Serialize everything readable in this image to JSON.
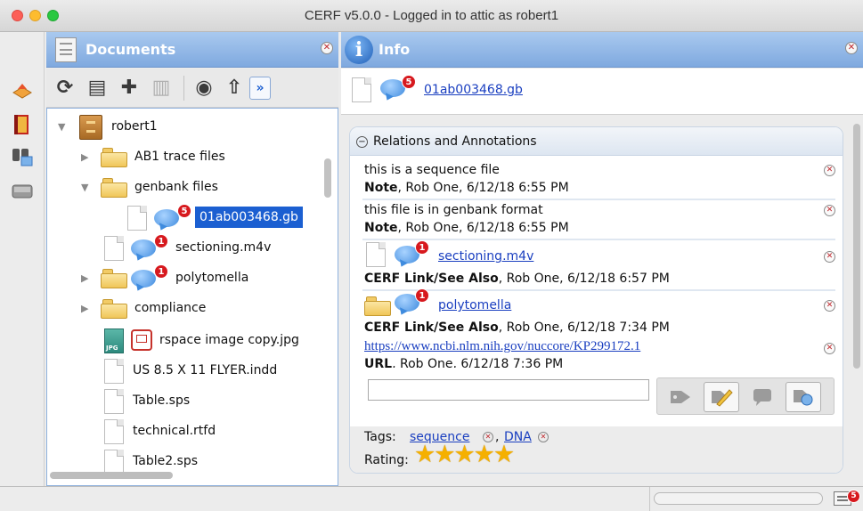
{
  "window": {
    "title": "CERF v5.0.0 - Logged in to attic as robert1",
    "lights": {
      "close": "#fc5f57",
      "minimize": "#fdbc2e",
      "zoom": "#29c840"
    }
  },
  "documents_panel": {
    "title": "Documents",
    "toolbar": [
      {
        "name": "refresh-icon",
        "glyph": "⟳"
      },
      {
        "name": "new-folder-icon",
        "glyph": "▤"
      },
      {
        "name": "add-icon",
        "glyph": "✚"
      },
      {
        "name": "drawer-icon",
        "glyph": "▥"
      },
      {
        "name": "view-icon",
        "glyph": "◉"
      },
      {
        "name": "upload-icon",
        "glyph": "⇧"
      },
      {
        "name": "more-icon",
        "glyph": "»"
      }
    ],
    "tree": [
      {
        "label": "robert1",
        "type": "root",
        "indent": 0,
        "expanded": true
      },
      {
        "label": "AB1 trace files",
        "type": "folder",
        "indent": 1,
        "expanded": false
      },
      {
        "label": "genbank files",
        "type": "folder",
        "indent": 1,
        "expanded": true
      },
      {
        "label": "01ab003468.gb",
        "type": "file",
        "indent": 2,
        "badge": "5",
        "selected": true
      },
      {
        "label": "sectioning.m4v",
        "type": "file",
        "indent": 1,
        "badge": "1"
      },
      {
        "label": "polytomella",
        "type": "folder",
        "indent": 1,
        "expanded": false,
        "badge": "1"
      },
      {
        "label": "compliance",
        "type": "folder",
        "indent": 1,
        "expanded": false
      },
      {
        "label": "rspace image copy.jpg",
        "type": "jpg",
        "indent": 1,
        "jpg_text": "JPG"
      },
      {
        "label": "US 8.5 X 11 FLYER.indd",
        "type": "file",
        "indent": 1
      },
      {
        "label": "Table.sps",
        "type": "file",
        "indent": 1
      },
      {
        "label": "technical.rtfd",
        "type": "file",
        "indent": 1
      },
      {
        "label": "Table2.sps",
        "type": "file",
        "indent": 1
      }
    ]
  },
  "info_panel": {
    "title": "Info",
    "document": {
      "name": "01ab003468.gb",
      "badge": "5"
    },
    "section_title": "Relations and Annotations",
    "annotations": [
      {
        "text": "this is a sequence file",
        "kind": "Note",
        "meta": ", Rob One, 6/12/18 6:55 PM"
      },
      {
        "text": "this file is in genbank format",
        "kind": "Note",
        "meta": ", Rob One, 6/12/18 6:55 PM"
      },
      {
        "link": "sectioning.m4v",
        "badge": "1",
        "kind": "CERF Link/See Also",
        "meta": ", Rob One, 6/12/18 6:57 PM"
      },
      {
        "link": "polytomella",
        "badge": "1",
        "kind": "CERF Link/See Also",
        "meta": ", Rob One, 6/12/18 7:34 PM"
      },
      {
        "url": "https://www.ncbi.nlm.nih.gov/nuccore/KP299172.1",
        "kind": "URL",
        "meta": ", Rob One, 6/12/18 7:36 PM"
      }
    ],
    "tags_label": "Tags:",
    "tags": [
      "sequence",
      "DNA"
    ],
    "rating_label": "Rating:",
    "rating": 5
  },
  "statusbar": {
    "badge": "5"
  },
  "colors": {
    "accent": "#1b5fd1",
    "header": "#8fb4e5",
    "badge": "#d7191e",
    "link": "#1a3fc0"
  }
}
